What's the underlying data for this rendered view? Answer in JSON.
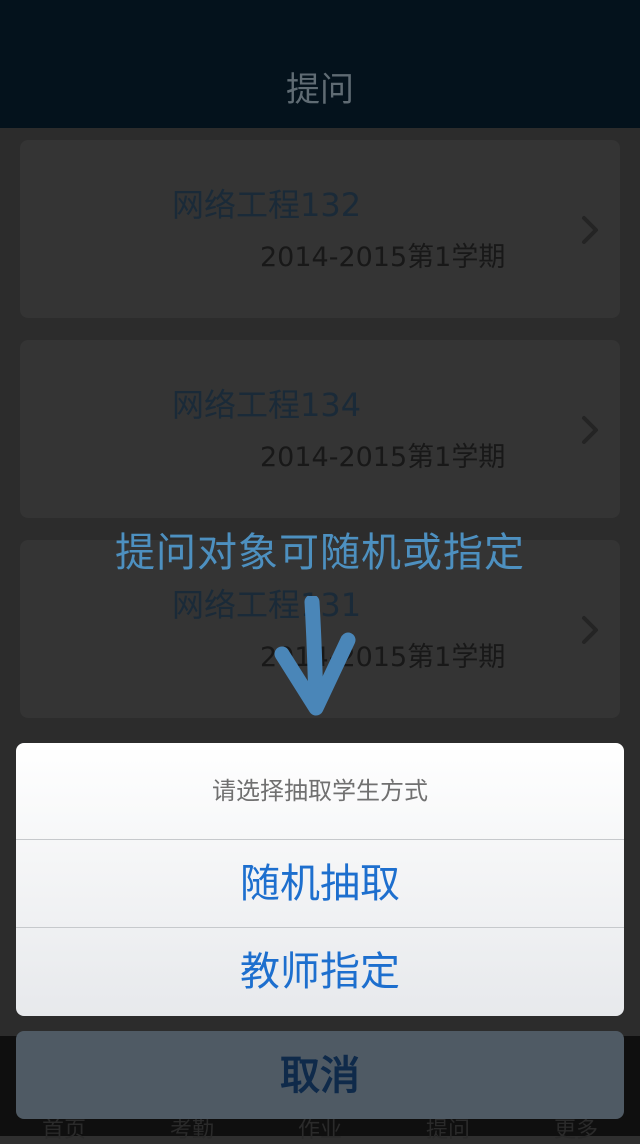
{
  "nav": {
    "title": "提问"
  },
  "classes": [
    {
      "name": "网络工程132",
      "term": "2014-2015第1学期"
    },
    {
      "name": "网络工程134",
      "term": "2014-2015第1学期"
    },
    {
      "name": "网络工程131",
      "term": "2014-2015第1学期"
    }
  ],
  "tabbar": {
    "items": [
      "首页",
      "考勤",
      "作业",
      "提问",
      "更多"
    ],
    "active": "提问"
  },
  "overlay": {
    "hint": "提问对象可随机或指定",
    "arrow_icon": "down-arrow-icon",
    "hint_color": "#4d90c0"
  },
  "sheet": {
    "title": "请选择抽取学生方式",
    "options": [
      "随机抽取",
      "教师指定"
    ],
    "cancel": "取消",
    "accent": "#1d6fce"
  },
  "icons": {
    "chevron": "chevron-right-icon"
  }
}
